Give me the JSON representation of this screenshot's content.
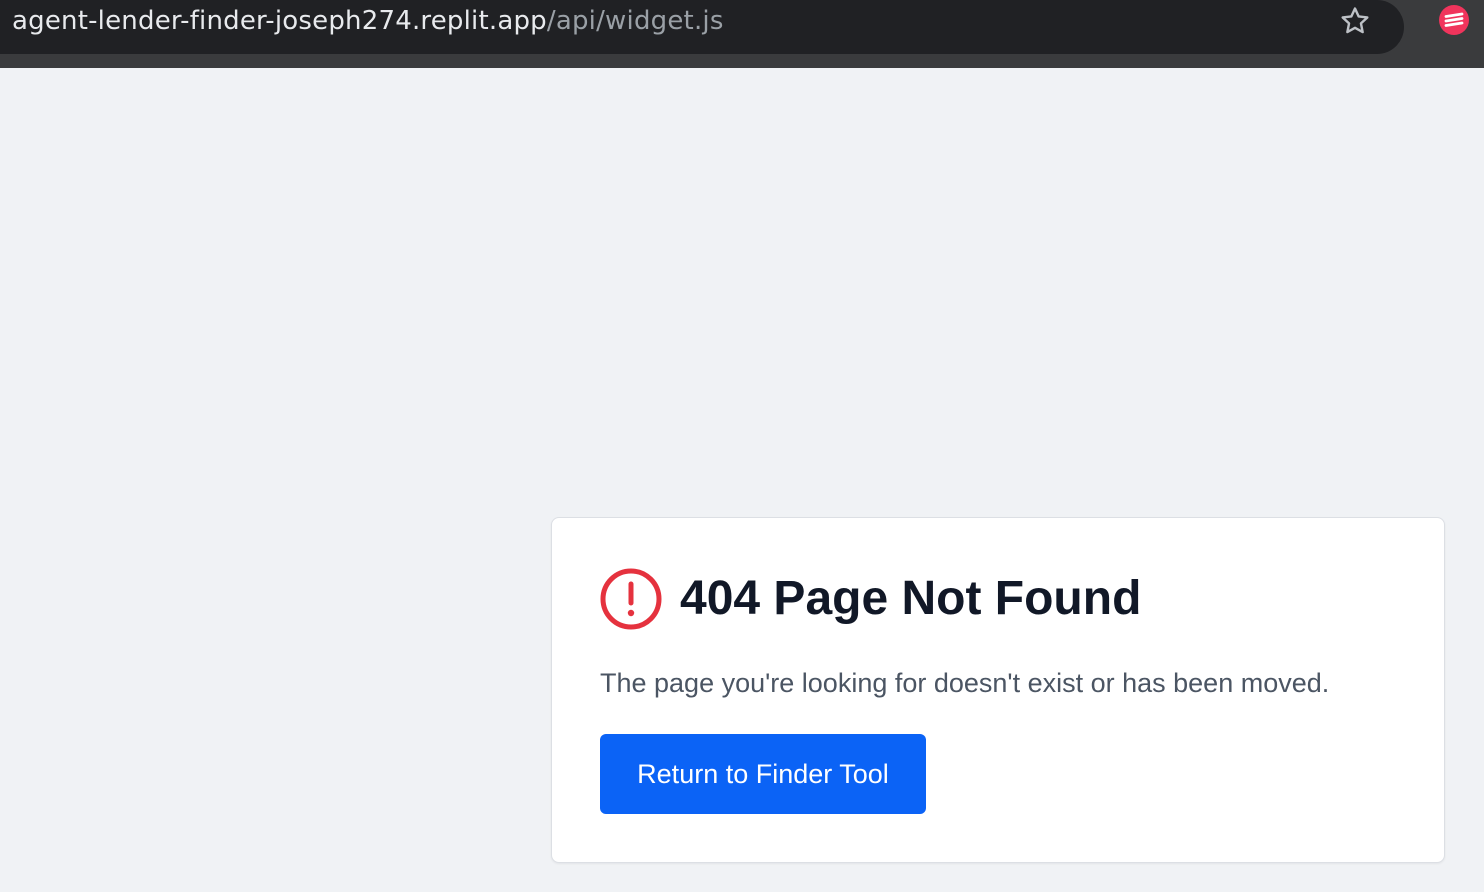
{
  "browser": {
    "url_host": "agent-lender-finder-joseph274.replit.app",
    "url_path": "/api/widget.js",
    "bookmark_icon": "star-outline-icon",
    "extension_icon": "extension-icon"
  },
  "error_card": {
    "icon": "alert-circle-icon",
    "title": "404 Page Not Found",
    "message": "The page you're looking for doesn't exist or has been moved.",
    "button_label": "Return to Finder Tool"
  },
  "colors": {
    "page_background": "#f0f2f5",
    "browser_dark": "#202124",
    "alert_red": "#e5323e",
    "button_blue": "#0b63f6",
    "title_text": "#111827",
    "body_text": "#4b5563",
    "extension_pink": "#f0345c"
  }
}
